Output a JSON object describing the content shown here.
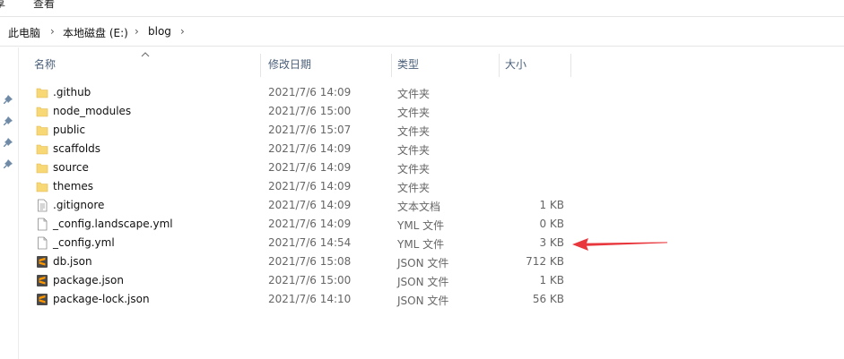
{
  "ribbon": {
    "tabs": [
      "享",
      "查看"
    ]
  },
  "breadcrumb": [
    "此电脑",
    "本地磁盘 (E:)",
    "blog"
  ],
  "columns": {
    "name": "名称",
    "date": "修改日期",
    "type": "类型",
    "size": "大小"
  },
  "files": [
    {
      "name": ".github",
      "date": "2021/7/6 14:09",
      "type": "文件夹",
      "size": "",
      "icon": "folder-icon"
    },
    {
      "name": "node_modules",
      "date": "2021/7/6 15:00",
      "type": "文件夹",
      "size": "",
      "icon": "folder-icon"
    },
    {
      "name": "public",
      "date": "2021/7/6 15:07",
      "type": "文件夹",
      "size": "",
      "icon": "folder-icon"
    },
    {
      "name": "scaffolds",
      "date": "2021/7/6 14:09",
      "type": "文件夹",
      "size": "",
      "icon": "folder-icon"
    },
    {
      "name": "source",
      "date": "2021/7/6 14:09",
      "type": "文件夹",
      "size": "",
      "icon": "folder-icon"
    },
    {
      "name": "themes",
      "date": "2021/7/6 14:09",
      "type": "文件夹",
      "size": "",
      "icon": "folder-icon"
    },
    {
      "name": ".gitignore",
      "date": "2021/7/6 14:09",
      "type": "文本文档",
      "size": "1 KB",
      "icon": "text-file-icon"
    },
    {
      "name": "_config.landscape.yml",
      "date": "2021/7/6 14:09",
      "type": "YML 文件",
      "size": "0 KB",
      "icon": "file-icon"
    },
    {
      "name": "_config.yml",
      "date": "2021/7/6 14:54",
      "type": "YML 文件",
      "size": "3 KB",
      "icon": "file-icon"
    },
    {
      "name": "db.json",
      "date": "2021/7/6 15:08",
      "type": "JSON 文件",
      "size": "712 KB",
      "icon": "sublime-file-icon"
    },
    {
      "name": "package.json",
      "date": "2021/7/6 15:00",
      "type": "JSON 文件",
      "size": "1 KB",
      "icon": "sublime-file-icon"
    },
    {
      "name": "package-lock.json",
      "date": "2021/7/6 14:10",
      "type": "JSON 文件",
      "size": "56 KB",
      "icon": "sublime-file-icon"
    }
  ],
  "colors": {
    "folder": "#f8d775",
    "sublime": "#4a4a4a",
    "sublime_mark": "#ff9800",
    "annotation": "#e8383d",
    "header_text": "#4c607a"
  }
}
